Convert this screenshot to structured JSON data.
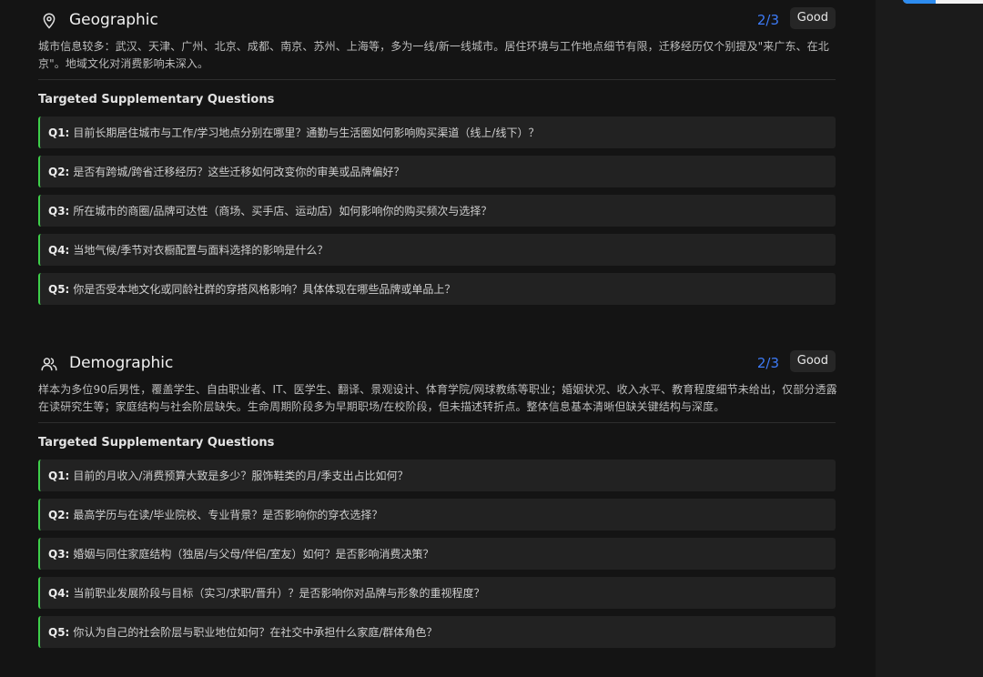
{
  "sections": [
    {
      "icon": "map-pin-icon",
      "title": "Geographic",
      "score": "2/3",
      "badge": "Good",
      "description": "城市信息较多：武汉、天津、广州、北京、成都、南京、苏州、上海等，多为一线/新一线城市。居住环境与工作地点细节有限，迁移经历仅个别提及\"来广东、在北京\"。地域文化对消费影响未深入。",
      "questions_title": "Targeted Supplementary Questions",
      "questions": [
        {
          "num": "Q1:",
          "text": "目前长期居住城市与工作/学习地点分别在哪里？通勤与生活圈如何影响购买渠道（线上/线下）？"
        },
        {
          "num": "Q2:",
          "text": "是否有跨城/跨省迁移经历？这些迁移如何改变你的审美或品牌偏好？"
        },
        {
          "num": "Q3:",
          "text": "所在城市的商圈/品牌可达性（商场、买手店、运动店）如何影响你的购买频次与选择？"
        },
        {
          "num": "Q4:",
          "text": "当地气候/季节对衣橱配置与面料选择的影响是什么？"
        },
        {
          "num": "Q5:",
          "text": "你是否受本地文化或同龄社群的穿搭风格影响？具体体现在哪些品牌或单品上？"
        }
      ]
    },
    {
      "icon": "users-icon",
      "title": "Demographic",
      "score": "2/3",
      "badge": "Good",
      "description": "样本为多位90后男性，覆盖学生、自由职业者、IT、医学生、翻译、景观设计、体育学院/网球教练等职业；婚姻状况、收入水平、教育程度细节未给出，仅部分透露在读研究生等；家庭结构与社会阶层缺失。生命周期阶段多为早期职场/在校阶段，但未描述转折点。整体信息基本清晰但缺关键结构与深度。",
      "questions_title": "Targeted Supplementary Questions",
      "questions": [
        {
          "num": "Q1:",
          "text": "目前的月收入/消费预算大致是多少？服饰鞋类的月/季支出占比如何？"
        },
        {
          "num": "Q2:",
          "text": "最高学历与在读/毕业院校、专业背景？是否影响你的穿衣选择？"
        },
        {
          "num": "Q3:",
          "text": "婚姻与同住家庭结构（独居/与父母/伴侣/室友）如何？是否影响消费决策？"
        },
        {
          "num": "Q4:",
          "text": "当前职业发展阶段与目标（实习/求职/晋升）？是否影响你对品牌与形象的重视程度？"
        },
        {
          "num": "Q5:",
          "text": "你认为自己的社会阶层与职业地位如何？在社交中承担什么家庭/群体角色？"
        }
      ]
    }
  ]
}
